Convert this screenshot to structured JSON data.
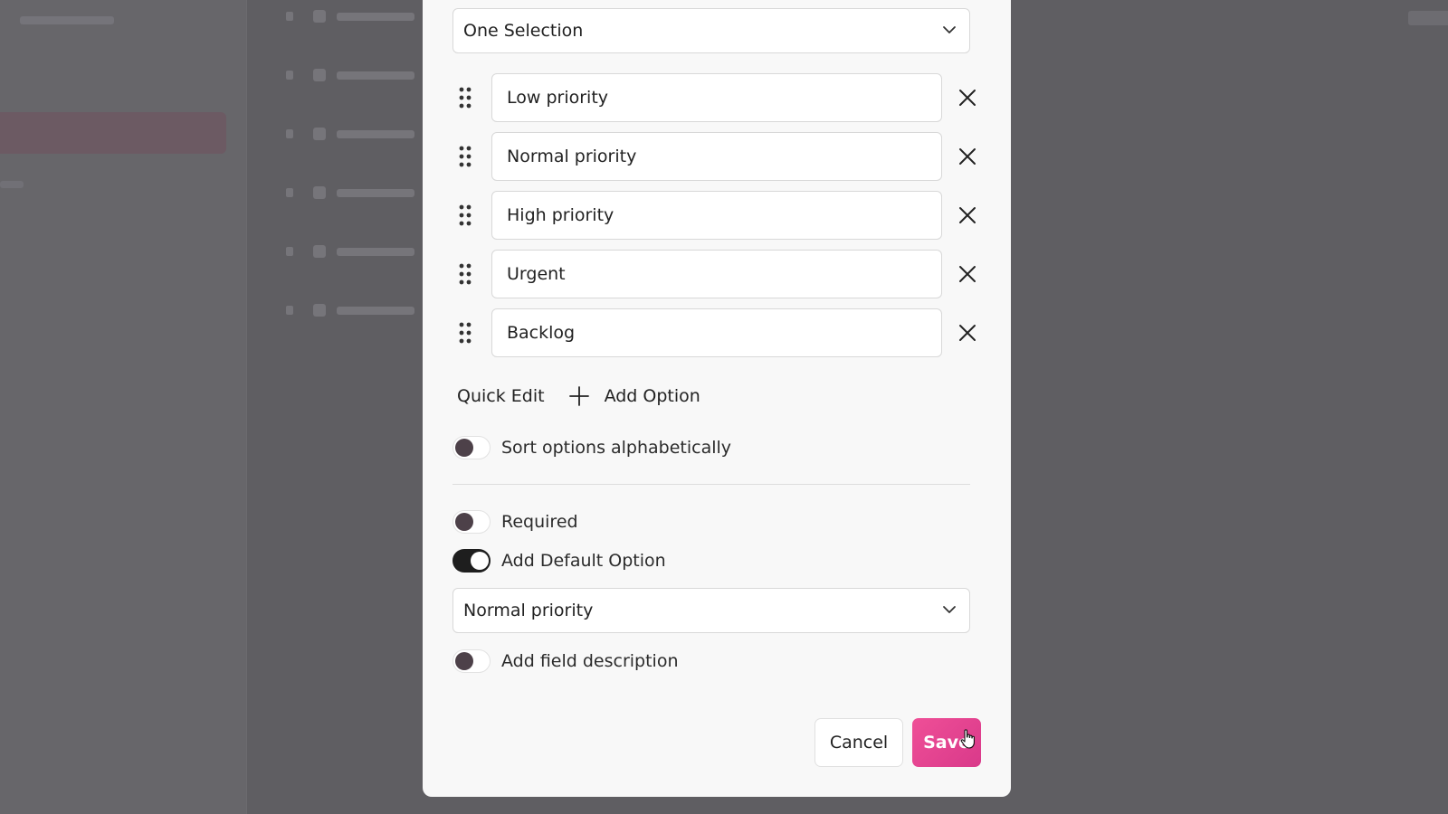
{
  "background": {
    "note_colors": {
      "overlay": "#5f5e62"
    }
  },
  "field_type_select": {
    "value": "One Selection",
    "icon": "chevron-down-icon"
  },
  "options": [
    {
      "label": "Low priority"
    },
    {
      "label": "Normal priority"
    },
    {
      "label": "High priority"
    },
    {
      "label": "Urgent"
    },
    {
      "label": "Backlog"
    }
  ],
  "actions": {
    "quick_edit": "Quick Edit",
    "add_option": "Add Option"
  },
  "toggles": {
    "sort_alpha": {
      "label": "Sort options alphabetically",
      "on": false
    },
    "required": {
      "label": "Required",
      "on": false
    },
    "default_option": {
      "label": "Add Default Option",
      "on": true
    },
    "description": {
      "label": "Add field description",
      "on": false
    }
  },
  "default_select": {
    "value": "Normal priority"
  },
  "footer": {
    "cancel": "Cancel",
    "save": "Save"
  },
  "colors": {
    "accent": "#e6448f",
    "toggle_on": "#1e1e1e",
    "knob": "#4d4149"
  }
}
